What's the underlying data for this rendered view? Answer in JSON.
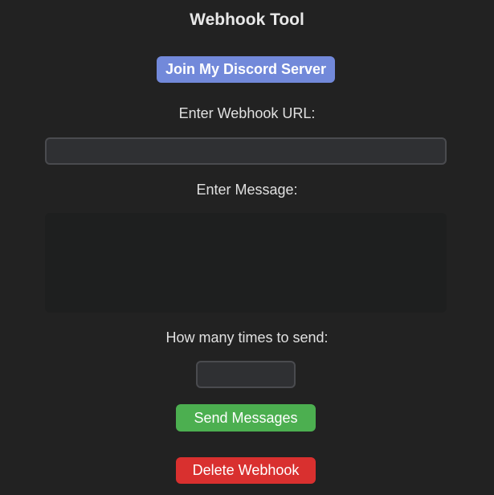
{
  "app": {
    "title": "Webhook Tool"
  },
  "discord_button": {
    "label": "Join My Discord Server",
    "color": "#7289da"
  },
  "webhook_url": {
    "label": "Enter Webhook URL:",
    "value": "",
    "placeholder": ""
  },
  "message": {
    "label": "Enter Message:",
    "value": "",
    "placeholder": ""
  },
  "send_count": {
    "label": "How many times to send:",
    "value": "",
    "placeholder": ""
  },
  "send_button": {
    "label": "Send Messages",
    "color": "#4caf50"
  },
  "delete_button": {
    "label": "Delete Webhook",
    "color": "#d9302f"
  },
  "theme": {
    "background": "#222222",
    "text": "#e0e0e0"
  }
}
